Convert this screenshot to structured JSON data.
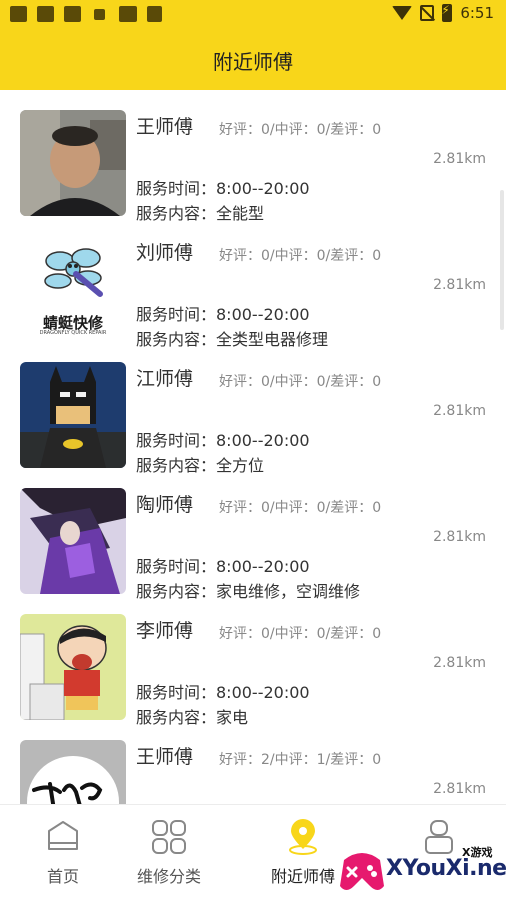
{
  "status_bar": {
    "time": "6:51"
  },
  "header": {
    "title": "附近师傅"
  },
  "masters": [
    {
      "name": "王师傅",
      "rating": "好评：0/中评：0/差评：0",
      "distance": "2.81km",
      "service_time": "服务时间：8:00--20:00",
      "service_content": "服务内容：全能型",
      "avatar_icon": "man-photo-avatar"
    },
    {
      "name": "刘师傅",
      "rating": "好评：0/中评：0/差评：0",
      "distance": "2.81km",
      "service_time": "服务时间：8:00--20:00",
      "service_content": "服务内容：全类型电器修理",
      "avatar_icon": "dragonfly-logo-avatar",
      "avatar_text": "蜻蜓快修",
      "avatar_subtext": "DRAGONFLY QUICK REPAIR"
    },
    {
      "name": "江师傅",
      "rating": "好评：0/中评：0/差评：0",
      "distance": "2.81km",
      "service_time": "服务时间：8:00--20:00",
      "service_content": "服务内容：全方位",
      "avatar_icon": "lego-batman-avatar"
    },
    {
      "name": "陶师傅",
      "rating": "好评：0/中评：0/差评：0",
      "distance": "2.81km",
      "service_time": "服务时间：8:00--20:00",
      "service_content": "服务内容：家电维修，空调维修",
      "avatar_icon": "anime-character-avatar"
    },
    {
      "name": "李师傅",
      "rating": "好评：0/中评：0/差评：0",
      "distance": "2.81km",
      "service_time": "服务时间：8:00--20:00",
      "service_content": "服务内容：家电",
      "avatar_icon": "cartoon-boy-avatar"
    },
    {
      "name": "王师傅",
      "rating": "好评：2/中评：1/差评：0",
      "distance": "2.81km",
      "service_time": "",
      "service_content": "",
      "avatar_icon": "signature-avatar"
    }
  ],
  "tabs": [
    {
      "label": "首页",
      "icon": "home-icon"
    },
    {
      "label": "维修分类",
      "icon": "grid-icon"
    },
    {
      "label": "附近师傅",
      "icon": "location-pin-icon",
      "active": true
    },
    {
      "label": "",
      "icon": "profile-icon"
    }
  ],
  "watermark": {
    "text": "XYouXi.net",
    "small_text": "X游戏"
  },
  "colors": {
    "brand_yellow": "#f8d61a",
    "text_primary": "#333333",
    "text_secondary": "#888888"
  }
}
